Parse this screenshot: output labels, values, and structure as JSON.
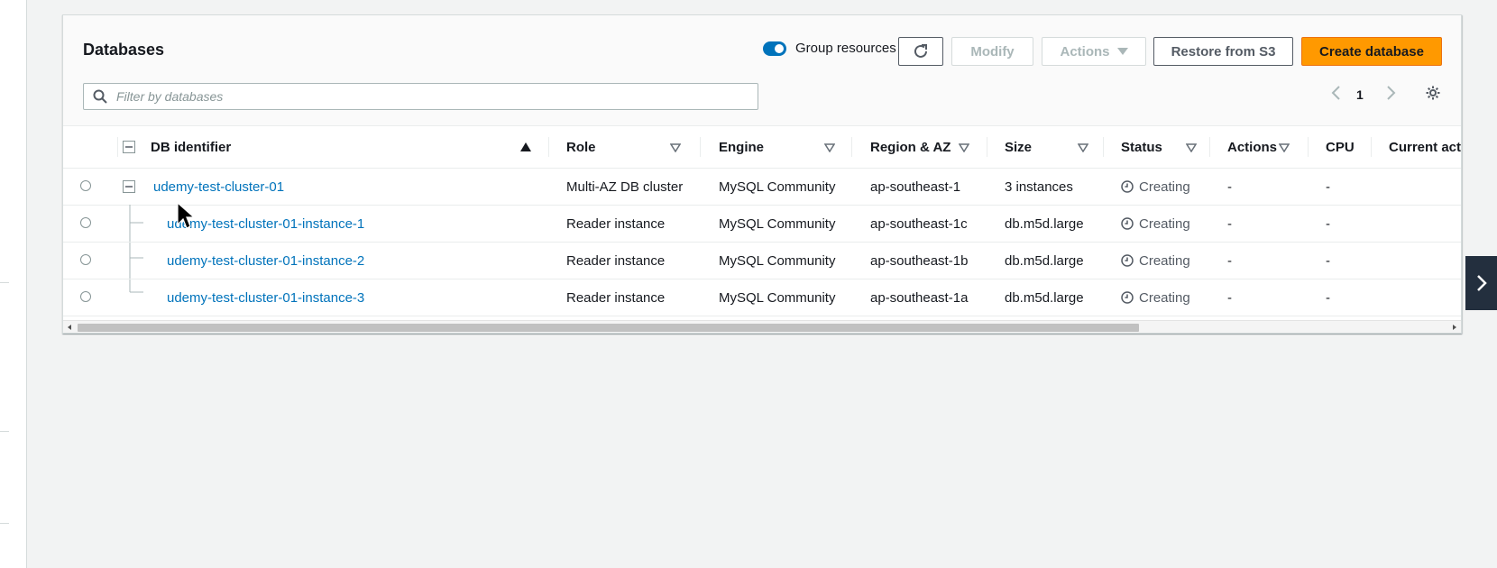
{
  "panel": {
    "title": "Databases"
  },
  "toolbar": {
    "group_resources_label": "Group resources",
    "group_resources_on": true,
    "modify_label": "Modify",
    "actions_label": "Actions",
    "restore_label": "Restore from S3",
    "create_label": "Create database"
  },
  "search": {
    "placeholder": "Filter by databases",
    "value": ""
  },
  "pagination": {
    "current_page": "1"
  },
  "table": {
    "columns": [
      "DB identifier",
      "Role",
      "Engine",
      "Region & AZ",
      "Size",
      "Status",
      "Actions",
      "CPU",
      "Current activity"
    ],
    "rows": [
      {
        "identifier": "udemy-test-cluster-01",
        "role": "Multi-AZ DB cluster",
        "engine": "MySQL Community",
        "region": "ap-southeast-1",
        "size": "3 instances",
        "status": "Creating",
        "actions": "-",
        "cpu": "-",
        "activity": ""
      },
      {
        "identifier": "udemy-test-cluster-01-instance-1",
        "role": "Reader instance",
        "engine": "MySQL Community",
        "region": "ap-southeast-1c",
        "size": "db.m5d.large",
        "status": "Creating",
        "actions": "-",
        "cpu": "-",
        "activity": ""
      },
      {
        "identifier": "udemy-test-cluster-01-instance-2",
        "role": "Reader instance",
        "engine": "MySQL Community",
        "region": "ap-southeast-1b",
        "size": "db.m5d.large",
        "status": "Creating",
        "actions": "-",
        "cpu": "-",
        "activity": ""
      },
      {
        "identifier": "udemy-test-cluster-01-instance-3",
        "role": "Reader instance",
        "engine": "MySQL Community",
        "region": "ap-southeast-1a",
        "size": "db.m5d.large",
        "status": "Creating",
        "actions": "-",
        "cpu": "-",
        "activity": ""
      }
    ]
  },
  "colors": {
    "link": "#0073bb",
    "primary_button": "#ff9900",
    "toggle": "#0073bb",
    "side_toggle": "#232f3e"
  }
}
